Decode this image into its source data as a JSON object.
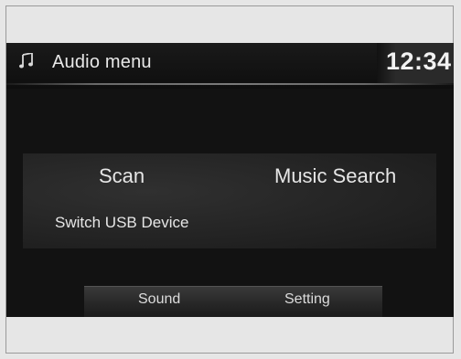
{
  "header": {
    "icon": "music-note-icon",
    "title": "Audio menu",
    "clock": "12:34"
  },
  "menu": {
    "scan": "Scan",
    "music_search": "Music Search",
    "switch_usb": "Switch USB Device"
  },
  "bottom": {
    "sound": "Sound",
    "setting": "Setting"
  },
  "colors": {
    "screen_bg": "#121212",
    "text": "#e6e6e6",
    "page_bg": "#e6e6e6"
  }
}
